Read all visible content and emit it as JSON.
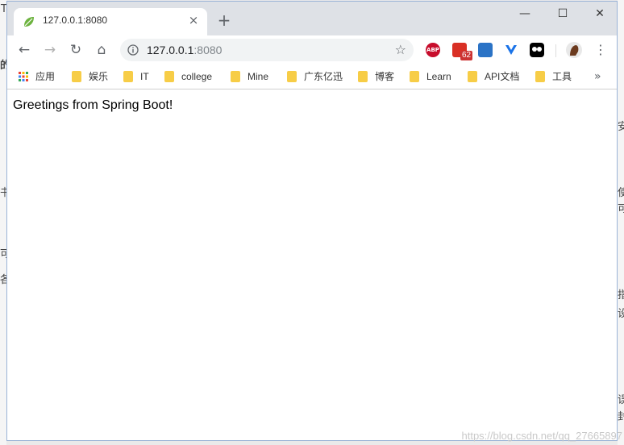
{
  "background": {
    "left_fragments": [
      "T",
      "的",
      "书",
      "可",
      "各"
    ],
    "right_fragments": [
      "安",
      "使",
      "可",
      "指",
      "设",
      "误",
      "封"
    ]
  },
  "tab": {
    "title": "127.0.0.1:8080",
    "favicon": "spring-leaf-icon",
    "close_icon": "×",
    "new_tab_icon": "+"
  },
  "window_controls": {
    "minimize": "—",
    "maximize": "☐",
    "close": "✕"
  },
  "toolbar": {
    "back": "←",
    "forward": "→",
    "reload": "↻",
    "home": "⌂",
    "url_host": "127.0.0.1",
    "url_port": ":8080",
    "star": "☆",
    "extensions": [
      {
        "name": "adblock-plus-icon",
        "label": "ABP",
        "color": "#c70d2c"
      },
      {
        "name": "extension-badge-icon",
        "label": "62",
        "color": "#d93025"
      },
      {
        "name": "translate-icon",
        "label": "",
        "color": "#2b73c6"
      },
      {
        "name": "vue-devtools-icon",
        "label": "",
        "color": "#1a73e8"
      },
      {
        "name": "tampermonkey-icon",
        "label": "",
        "color": "#000000"
      }
    ],
    "menu": "⋮"
  },
  "bookmarks": {
    "items": [
      "应用",
      "娱乐",
      "IT",
      "college",
      "Mine",
      "广东亿迅",
      "博客",
      "Learn",
      "API文档",
      "工具"
    ],
    "more": "»"
  },
  "page": {
    "greeting": "Greetings from Spring Boot!"
  },
  "watermark": "https://blog.csdn.net/qq_27665897",
  "colors": {
    "tabstrip": "#dee1e6",
    "folder": "#f7cd47",
    "omnibox": "#f1f3f4"
  }
}
